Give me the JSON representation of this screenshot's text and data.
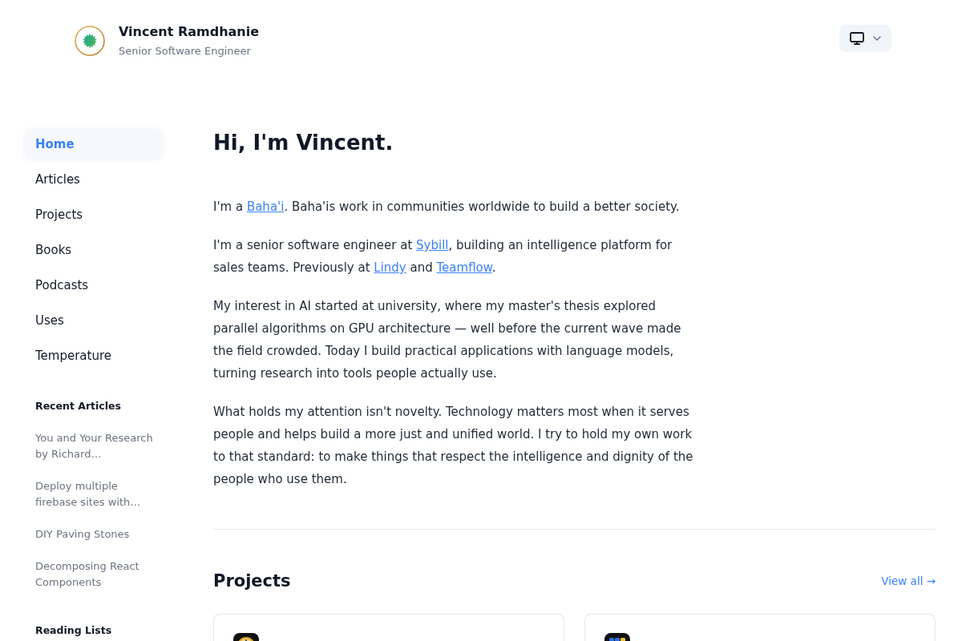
{
  "header": {
    "name": "Vincent Ramdhanie",
    "role": "Senior Software Engineer"
  },
  "sidebar": {
    "nav": [
      {
        "label": "Home",
        "selected": true
      },
      {
        "label": "Articles",
        "selected": false
      },
      {
        "label": "Projects",
        "selected": false
      },
      {
        "label": "Books",
        "selected": false
      },
      {
        "label": "Podcasts",
        "selected": false
      },
      {
        "label": "Uses",
        "selected": false
      },
      {
        "label": "Temperature",
        "selected": false
      }
    ],
    "recent_articles": {
      "title": "Recent Articles",
      "items": [
        "You and Your Research by Richard…",
        "Deploy multiple firebase sites with…",
        "DIY Paving Stones",
        "Decomposing React Components"
      ]
    },
    "reading_lists": {
      "title": "Reading Lists"
    }
  },
  "main": {
    "title": "Hi, I'm Vincent.",
    "paragraphs": [
      [
        {
          "kind": "text",
          "text": "I'm a "
        },
        {
          "kind": "link",
          "text": "Baha'i"
        },
        {
          "kind": "text",
          "text": ". Baha'is work in communities worldwide to build a better society."
        }
      ],
      [
        {
          "kind": "text",
          "text": "I'm a senior software engineer at "
        },
        {
          "kind": "link",
          "text": "Sybill"
        },
        {
          "kind": "text",
          "text": ", building an intelligence platform for sales teams. Previously at "
        },
        {
          "kind": "link",
          "text": "Lindy"
        },
        {
          "kind": "text",
          "text": " and "
        },
        {
          "kind": "link",
          "text": "Teamflow"
        },
        {
          "kind": "text",
          "text": "."
        }
      ],
      [
        {
          "kind": "text",
          "text": "My interest in AI started at university, where my master's thesis explored parallel algorithms on GPU architecture — well before the current wave made the field crowded. Today I build practical applications with language models, turning research into tools people actually use."
        }
      ],
      [
        {
          "kind": "text",
          "text": "What holds my attention isn't novelty. Technology matters most when it serves people and helps build a more just and unified world. I try to hold my own work to that standard: to make things that respect the intelligence and dignity of the people who use them."
        }
      ]
    ]
  },
  "projects": {
    "title": "Projects",
    "view_all": "View all →",
    "cards": [
      {
        "kind": "clock"
      },
      {
        "kind": "columns"
      }
    ]
  }
}
